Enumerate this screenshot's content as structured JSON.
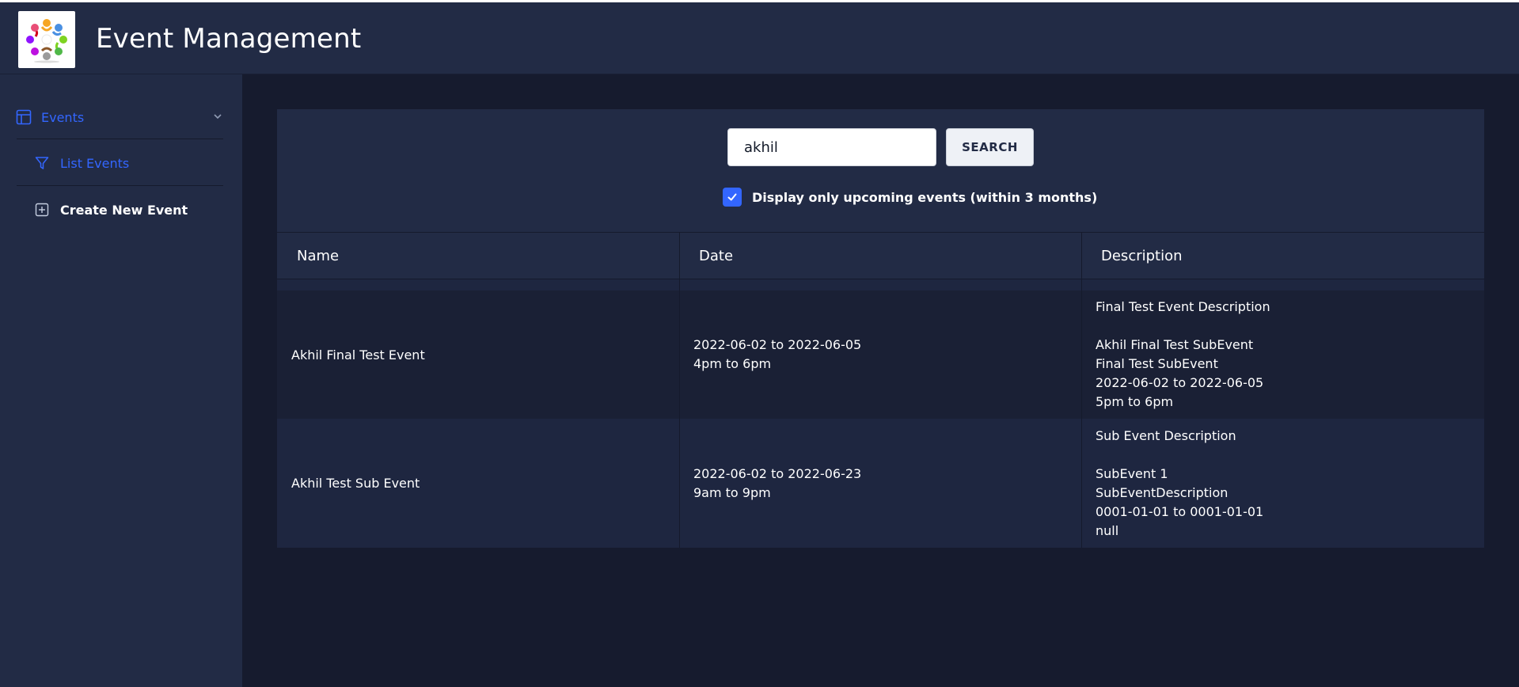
{
  "header": {
    "app_title": "Event Management",
    "logo_icon": "people-circle-logo"
  },
  "sidebar": {
    "events": {
      "label": "Events",
      "icon": "table-layout-icon",
      "expanded": true,
      "color": "#3366ff"
    },
    "items": [
      {
        "label": "List Events",
        "icon": "filter-icon",
        "active": true
      },
      {
        "label": "Create New Event",
        "icon": "plus-square-icon",
        "active": false
      }
    ]
  },
  "search": {
    "value": "akhil",
    "button_label": "SEARCH",
    "upcoming_checked": true,
    "upcoming_label": "Display only upcoming events (within 3 months)"
  },
  "table": {
    "columns": [
      "Name",
      "Date",
      "Description"
    ],
    "rows": [
      {
        "name": "Akhil Final Test Event",
        "date": [
          "2022-06-02 to 2022-06-05",
          "4pm to 6pm"
        ],
        "description": [
          "Final Test Event Description",
          "",
          "Akhil Final Test SubEvent",
          "Final Test SubEvent",
          "2022-06-02 to 2022-06-05",
          "5pm to 6pm"
        ]
      },
      {
        "name": "Akhil Test Sub Event",
        "date": [
          "2022-06-02 to 2022-06-23",
          "9am to 9pm"
        ],
        "description": [
          "Sub Event Description",
          "",
          "SubEvent 1",
          "SubEventDescription",
          "0001-01-01 to 0001-01-01",
          "null"
        ]
      }
    ]
  },
  "colors": {
    "background": "#161b2e",
    "panel": "#222b45",
    "accent": "#3366ff",
    "row_odd": "#1a2035",
    "row_even": "#1e2640"
  }
}
